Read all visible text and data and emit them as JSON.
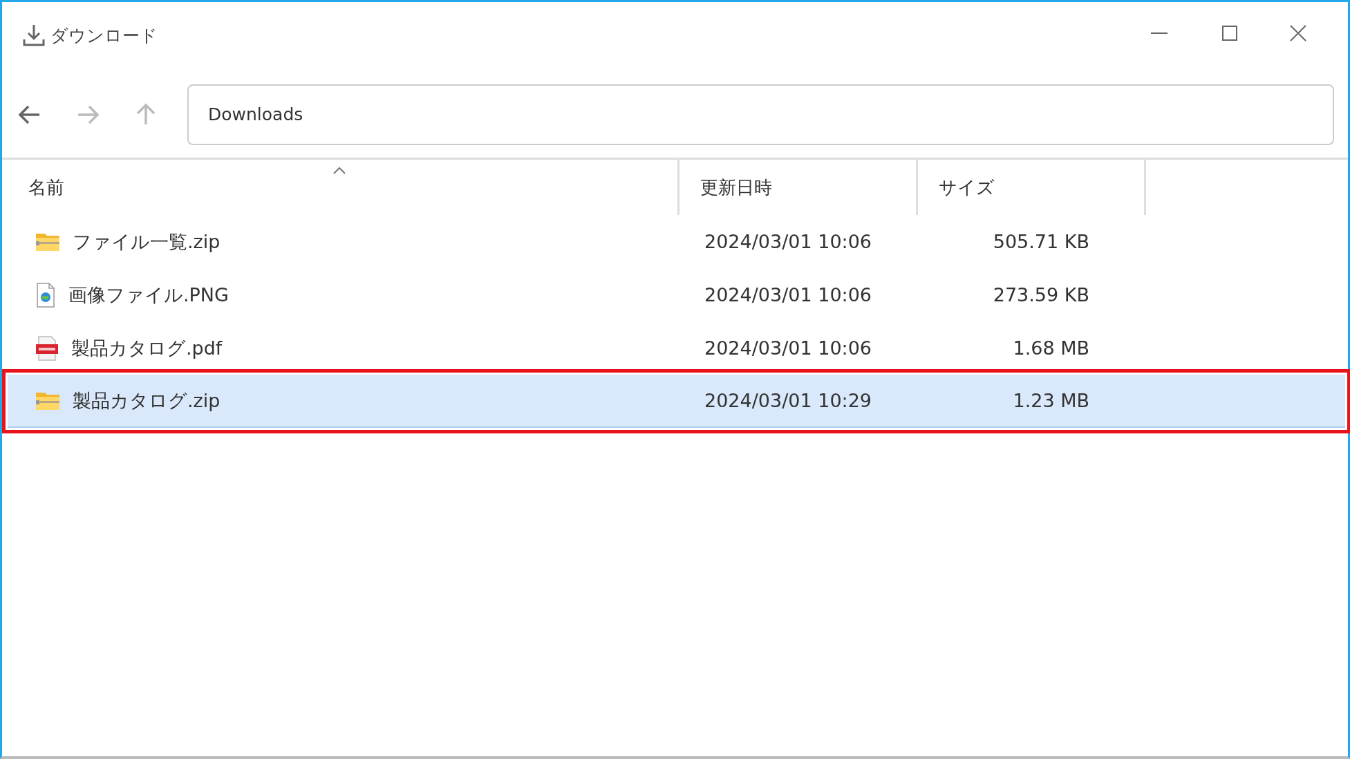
{
  "window": {
    "title": "ダウンロード"
  },
  "navigation": {
    "buttons": [
      {
        "kind": "back",
        "disabled": false
      },
      {
        "kind": "forward",
        "disabled": true
      },
      {
        "kind": "up",
        "disabled": true
      }
    ]
  },
  "address_bar": {
    "value": "Downloads"
  },
  "table": {
    "columns": [
      {
        "label": "名前",
        "sorted": true
      },
      {
        "label": "更新日時",
        "sorted": false
      },
      {
        "label": "サイズ",
        "sorted": false
      }
    ],
    "rows": [
      {
        "kind": "zip",
        "name": "ファイル一覧.zip",
        "modified": "2024/03/01 10:06",
        "size": "505.71 KB",
        "selected": false,
        "annotated": false
      },
      {
        "kind": "image",
        "name": "画像ファイル.PNG",
        "modified": "2024/03/01 10:06",
        "size": "273.59 KB",
        "selected": false,
        "annotated": false
      },
      {
        "kind": "pdf",
        "name": "製品カタログ.pdf",
        "modified": "2024/03/01 10:06",
        "size": "1.68 MB",
        "selected": false,
        "annotated": false
      },
      {
        "kind": "zip",
        "name": "製品カタログ.zip",
        "modified": "2024/03/01 10:29",
        "size": "1.23 MB",
        "selected": true,
        "annotated": true
      }
    ]
  }
}
